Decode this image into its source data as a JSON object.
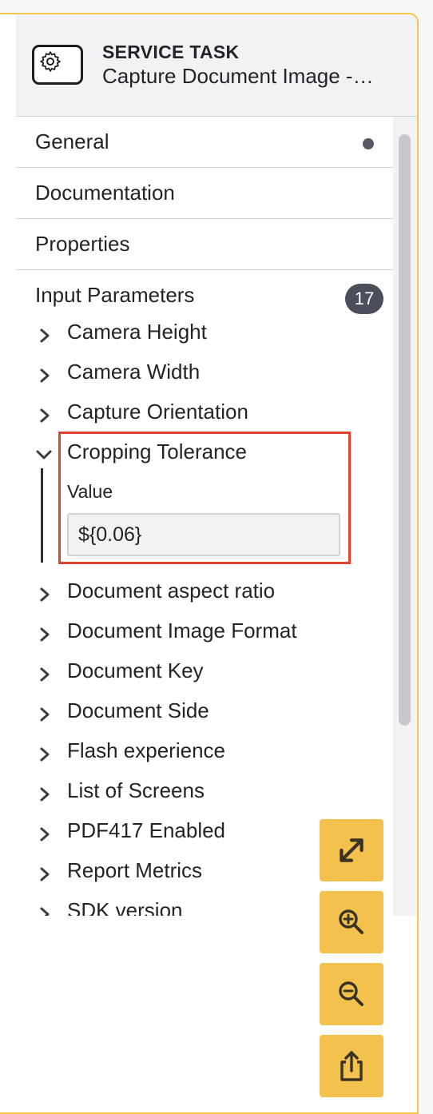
{
  "header": {
    "type_label": "SERVICE TASK",
    "name": "Capture Document Image -…"
  },
  "groups": [
    {
      "label": "General",
      "has_dot": true
    },
    {
      "label": "Documentation"
    },
    {
      "label": "Properties"
    }
  ],
  "input_parameters": {
    "label": "Input Parameters",
    "count": "17",
    "items_before": [
      "Camera Height",
      "Camera Width",
      "Capture Orientation"
    ],
    "expanded": {
      "label": "Cropping Tolerance",
      "field_label": "Value",
      "field_value": "${0.06}"
    },
    "items_after": [
      "Document aspect ratio",
      "Document Image Format",
      "Document Key",
      "Document Side",
      "Flash experience",
      "List of Screens",
      "PDF417 Enabled",
      "Report Metrics",
      "SDK version"
    ]
  },
  "icons": {
    "task": "gear-icon",
    "expand": "chevron-right-icon",
    "collapse": "chevron-down-icon",
    "fit": "diagonal-arrows-icon",
    "zoom_in": "zoom-in-icon",
    "zoom_out": "zoom-out-icon",
    "export": "share-icon"
  },
  "colors": {
    "accent": "#f2c14e",
    "highlight_border": "#e2412d",
    "badge": "#4a4f5b"
  }
}
